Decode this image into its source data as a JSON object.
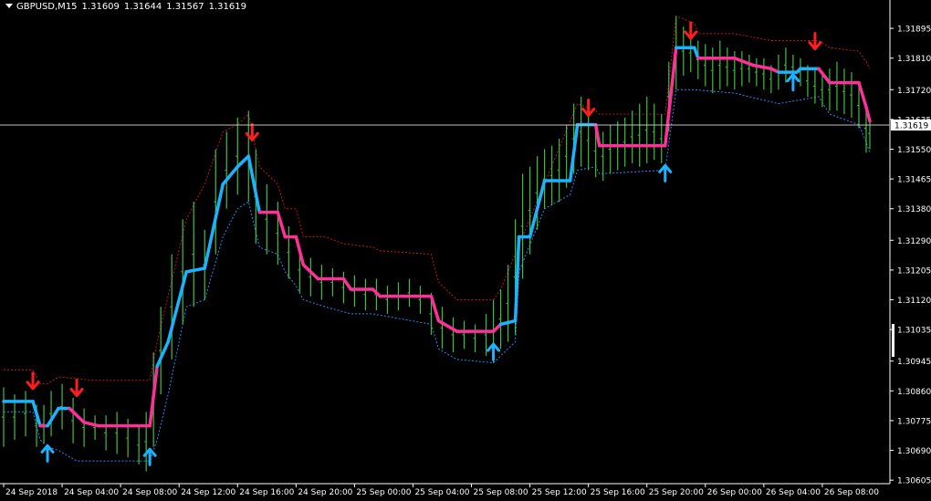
{
  "header": {
    "symbol": "GBPUSD,M15",
    "open": "1.31609",
    "high": "1.31644",
    "low": "1.31567",
    "close": "1.31619"
  },
  "colors": {
    "background": "#000000",
    "bars": "#3fbf3f",
    "up_trend": "#19b4ff",
    "down_trend": "#ff2f9a",
    "upper_band": "#c8141e",
    "lower_band": "#1e8cff",
    "buy_arrow": "#19b4ff",
    "sell_arrow": "#ff1e1e",
    "axis_text": "#ffffff",
    "price_line": "#c0c0c0"
  },
  "chart_data": {
    "type": "line",
    "current_price": {
      "value": 1.31619,
      "label": "1.31619"
    },
    "y_ticks": [
      1.31895,
      1.3181,
      1.3172,
      1.31635,
      1.3155,
      1.31465,
      1.3138,
      1.3129,
      1.31205,
      1.3112,
      1.31035,
      1.30945,
      1.3086,
      1.30775,
      1.3069,
      1.30605
    ],
    "y_tick_labels": [
      "1.31895",
      "1.31810",
      "1.31720",
      "1.31635",
      "1.31550",
      "1.31465",
      "1.31380",
      "1.31290",
      "1.31205",
      "1.31120",
      "1.31035",
      "1.30945",
      "1.30860",
      "1.30775",
      "1.30690",
      "1.30605"
    ],
    "x_labels": [
      "24 Sep 2018",
      "24 Sep 04:00",
      "24 Sep 08:00",
      "24 Sep 12:00",
      "24 Sep 16:00",
      "24 Sep 20:00",
      "25 Sep 00:00",
      "25 Sep 04:00",
      "25 Sep 08:00",
      "25 Sep 12:00",
      "25 Sep 16:00",
      "25 Sep 20:00",
      "26 Sep 00:00",
      "26 Sep 04:00",
      "26 Sep 08:00"
    ],
    "ylim": [
      1.30595,
      1.3195
    ],
    "trend_line": [
      [
        0,
        1.3083,
        "up"
      ],
      [
        8,
        1.3083,
        "up"
      ],
      [
        10,
        1.3076,
        "down"
      ],
      [
        12,
        1.3076,
        "up"
      ],
      [
        15,
        1.3081,
        "up"
      ],
      [
        18,
        1.3081,
        "down"
      ],
      [
        22,
        1.3077,
        "down"
      ],
      [
        26,
        1.3076,
        "down"
      ],
      [
        40,
        1.3076,
        "down"
      ],
      [
        42,
        1.3093,
        "up"
      ],
      [
        45,
        1.31,
        "up"
      ],
      [
        50,
        1.312,
        "up"
      ],
      [
        55,
        1.3121,
        "up"
      ],
      [
        60,
        1.3145,
        "up"
      ],
      [
        64,
        1.315,
        "up"
      ],
      [
        67,
        1.3153,
        "up"
      ],
      [
        70,
        1.3137,
        "down"
      ],
      [
        75,
        1.3137,
        "down"
      ],
      [
        77,
        1.313,
        "down"
      ],
      [
        80,
        1.313,
        "down"
      ],
      [
        82,
        1.3122,
        "down"
      ],
      [
        86,
        1.3118,
        "down"
      ],
      [
        93,
        1.3118,
        "down"
      ],
      [
        95,
        1.3115,
        "down"
      ],
      [
        101,
        1.3115,
        "down"
      ],
      [
        103,
        1.3113,
        "down"
      ],
      [
        117,
        1.3113,
        "down"
      ],
      [
        119,
        1.3106,
        "down"
      ],
      [
        124,
        1.3103,
        "down"
      ],
      [
        134,
        1.3103,
        "down"
      ],
      [
        136,
        1.3105,
        "up"
      ],
      [
        140,
        1.3106,
        "up"
      ],
      [
        141,
        1.313,
        "up"
      ],
      [
        144,
        1.313,
        "up"
      ],
      [
        148,
        1.3146,
        "up"
      ],
      [
        155,
        1.3146,
        "up"
      ],
      [
        157,
        1.3162,
        "up"
      ],
      [
        162,
        1.3162,
        "down"
      ],
      [
        163,
        1.3156,
        "down"
      ],
      [
        181,
        1.3156,
        "down"
      ],
      [
        184,
        1.3184,
        "up"
      ],
      [
        189,
        1.3184,
        "up"
      ],
      [
        190,
        1.3181,
        "down"
      ],
      [
        200,
        1.3181,
        "down"
      ],
      [
        205,
        1.3179,
        "down"
      ],
      [
        210,
        1.3178,
        "down"
      ],
      [
        212,
        1.3177,
        "up"
      ],
      [
        217,
        1.3177,
        "up"
      ],
      [
        218,
        1.3178,
        "up"
      ],
      [
        223,
        1.3178,
        "down"
      ],
      [
        226,
        1.3174,
        "down"
      ],
      [
        234,
        1.3174,
        "down"
      ],
      [
        236,
        1.3167,
        "down"
      ],
      [
        237,
        1.3163,
        "down"
      ]
    ],
    "upper_band": [
      [
        0,
        1.3092
      ],
      [
        8,
        1.3092
      ],
      [
        10,
        1.3088
      ],
      [
        12,
        1.3088
      ],
      [
        15,
        1.309
      ],
      [
        25,
        1.3089
      ],
      [
        30,
        1.3089
      ],
      [
        40,
        1.3089
      ],
      [
        42,
        1.31
      ],
      [
        50,
        1.3135
      ],
      [
        55,
        1.3145
      ],
      [
        60,
        1.316
      ],
      [
        64,
        1.3162
      ],
      [
        67,
        1.3165
      ],
      [
        70,
        1.315
      ],
      [
        75,
        1.3145
      ],
      [
        77,
        1.3138
      ],
      [
        80,
        1.3138
      ],
      [
        82,
        1.313
      ],
      [
        88,
        1.313
      ],
      [
        93,
        1.3128
      ],
      [
        101,
        1.3127
      ],
      [
        103,
        1.3126
      ],
      [
        117,
        1.3125
      ],
      [
        119,
        1.3117
      ],
      [
        124,
        1.3112
      ],
      [
        134,
        1.3112
      ],
      [
        136,
        1.3115
      ],
      [
        157,
        1.3168
      ],
      [
        162,
        1.3166
      ],
      [
        163,
        1.3165
      ],
      [
        181,
        1.3165
      ],
      [
        184,
        1.3193
      ],
      [
        189,
        1.3191
      ],
      [
        190,
        1.3188
      ],
      [
        200,
        1.3188
      ],
      [
        210,
        1.3186
      ],
      [
        223,
        1.3186
      ],
      [
        226,
        1.3184
      ],
      [
        234,
        1.3183
      ],
      [
        236,
        1.318
      ],
      [
        237,
        1.3178
      ]
    ],
    "lower_band": [
      [
        0,
        1.308
      ],
      [
        8,
        1.308
      ],
      [
        10,
        1.3072
      ],
      [
        12,
        1.307
      ],
      [
        15,
        1.3069
      ],
      [
        20,
        1.3066
      ],
      [
        25,
        1.3066
      ],
      [
        40,
        1.3066
      ],
      [
        42,
        1.3072
      ],
      [
        45,
        1.3085
      ],
      [
        50,
        1.311
      ],
      [
        55,
        1.3112
      ],
      [
        60,
        1.313
      ],
      [
        64,
        1.3138
      ],
      [
        67,
        1.314
      ],
      [
        70,
        1.3127
      ],
      [
        75,
        1.3125
      ],
      [
        77,
        1.312
      ],
      [
        80,
        1.3116
      ],
      [
        82,
        1.3112
      ],
      [
        88,
        1.311
      ],
      [
        95,
        1.3108
      ],
      [
        101,
        1.3108
      ],
      [
        117,
        1.3105
      ],
      [
        119,
        1.3098
      ],
      [
        124,
        1.3095
      ],
      [
        134,
        1.3094
      ],
      [
        136,
        1.3096
      ],
      [
        140,
        1.31
      ],
      [
        141,
        1.312
      ],
      [
        148,
        1.3138
      ],
      [
        155,
        1.3142
      ],
      [
        157,
        1.3149
      ],
      [
        162,
        1.315
      ],
      [
        163,
        1.3148
      ],
      [
        181,
        1.3149
      ],
      [
        184,
        1.3172
      ],
      [
        189,
        1.3172
      ],
      [
        200,
        1.3171
      ],
      [
        212,
        1.3168
      ],
      [
        223,
        1.317
      ],
      [
        226,
        1.3165
      ],
      [
        234,
        1.3162
      ],
      [
        236,
        1.3157
      ],
      [
        237,
        1.3154
      ]
    ],
    "price_ranges": [
      [
        0,
        1.307,
        1.3087
      ],
      [
        3,
        1.3072,
        1.3085
      ],
      [
        6,
        1.3073,
        1.3086
      ],
      [
        9,
        1.307,
        1.3082
      ],
      [
        11,
        1.3071,
        1.3082
      ],
      [
        13,
        1.3073,
        1.3086
      ],
      [
        16,
        1.3075,
        1.3088
      ],
      [
        19,
        1.3071,
        1.3084
      ],
      [
        22,
        1.307,
        1.3081
      ],
      [
        25,
        1.3072,
        1.3079
      ],
      [
        28,
        1.3069,
        1.3079
      ],
      [
        31,
        1.3068,
        1.308
      ],
      [
        34,
        1.3067,
        1.3078
      ],
      [
        37,
        1.3065,
        1.3076
      ],
      [
        39,
        1.3063,
        1.308
      ],
      [
        41,
        1.307,
        1.3097
      ],
      [
        43,
        1.3085,
        1.311
      ],
      [
        46,
        1.3095,
        1.3125
      ],
      [
        49,
        1.3105,
        1.3135
      ],
      [
        52,
        1.311,
        1.314
      ],
      [
        55,
        1.3112,
        1.3132
      ],
      [
        58,
        1.3125,
        1.3155
      ],
      [
        61,
        1.3138,
        1.316
      ],
      [
        64,
        1.3142,
        1.3164
      ],
      [
        67,
        1.314,
        1.3166
      ],
      [
        69,
        1.3128,
        1.3155
      ],
      [
        72,
        1.3125,
        1.3145
      ],
      [
        75,
        1.3122,
        1.314
      ],
      [
        78,
        1.3118,
        1.3133
      ],
      [
        81,
        1.3114,
        1.3127
      ],
      [
        84,
        1.3113,
        1.3124
      ],
      [
        87,
        1.3112,
        1.3122
      ],
      [
        90,
        1.3113,
        1.3121
      ],
      [
        93,
        1.3111,
        1.312
      ],
      [
        96,
        1.311,
        1.3119
      ],
      [
        99,
        1.3109,
        1.3118
      ],
      [
        102,
        1.3109,
        1.3118
      ],
      [
        105,
        1.3108,
        1.3116
      ],
      [
        108,
        1.3109,
        1.3117
      ],
      [
        111,
        1.311,
        1.3118
      ],
      [
        114,
        1.3108,
        1.3116
      ],
      [
        117,
        1.3102,
        1.3114
      ],
      [
        120,
        1.3098,
        1.311
      ],
      [
        123,
        1.3097,
        1.3107
      ],
      [
        126,
        1.3098,
        1.3106
      ],
      [
        129,
        1.3097,
        1.3105
      ],
      [
        132,
        1.3096,
        1.3108
      ],
      [
        134,
        1.3094,
        1.3112
      ],
      [
        136,
        1.3098,
        1.3115
      ],
      [
        138,
        1.31,
        1.3122
      ],
      [
        140,
        1.3102,
        1.3135
      ],
      [
        142,
        1.3118,
        1.3148
      ],
      [
        144,
        1.3125,
        1.315
      ],
      [
        146,
        1.3132,
        1.3153
      ],
      [
        148,
        1.3138,
        1.3155
      ],
      [
        150,
        1.3139,
        1.3156
      ],
      [
        152,
        1.314,
        1.3158
      ],
      [
        154,
        1.3144,
        1.3162
      ],
      [
        156,
        1.3148,
        1.3168
      ],
      [
        158,
        1.315,
        1.317
      ],
      [
        160,
        1.3149,
        1.3166
      ],
      [
        162,
        1.3147,
        1.3162
      ],
      [
        164,
        1.3146,
        1.316
      ],
      [
        166,
        1.3148,
        1.3162
      ],
      [
        168,
        1.3149,
        1.3163
      ],
      [
        170,
        1.315,
        1.3164
      ],
      [
        172,
        1.3151,
        1.3166
      ],
      [
        174,
        1.315,
        1.3168
      ],
      [
        176,
        1.3151,
        1.317
      ],
      [
        178,
        1.3152,
        1.3168
      ],
      [
        180,
        1.3151,
        1.3165
      ],
      [
        182,
        1.316,
        1.318
      ],
      [
        184,
        1.3172,
        1.3193
      ],
      [
        186,
        1.3176,
        1.319
      ],
      [
        188,
        1.3177,
        1.3188
      ],
      [
        190,
        1.3175,
        1.3186
      ],
      [
        192,
        1.3173,
        1.3185
      ],
      [
        194,
        1.3171,
        1.3184
      ],
      [
        196,
        1.3172,
        1.3186
      ],
      [
        198,
        1.3173,
        1.3184
      ],
      [
        200,
        1.3172,
        1.3183
      ],
      [
        202,
        1.3173,
        1.3183
      ],
      [
        204,
        1.3174,
        1.3182
      ],
      [
        206,
        1.3173,
        1.3181
      ],
      [
        208,
        1.3172,
        1.3181
      ],
      [
        210,
        1.3171,
        1.3179
      ],
      [
        212,
        1.3172,
        1.3182
      ],
      [
        214,
        1.3174,
        1.3184
      ],
      [
        216,
        1.3175,
        1.3182
      ],
      [
        218,
        1.3173,
        1.3181
      ],
      [
        220,
        1.317,
        1.3179
      ],
      [
        222,
        1.3168,
        1.3178
      ],
      [
        224,
        1.3167,
        1.3177
      ],
      [
        226,
        1.3166,
        1.3178
      ],
      [
        228,
        1.3166,
        1.318
      ],
      [
        230,
        1.3165,
        1.3178
      ],
      [
        232,
        1.3164,
        1.3177
      ],
      [
        234,
        1.3161,
        1.3174
      ],
      [
        236,
        1.3154,
        1.3168
      ],
      [
        237,
        1.3155,
        1.3164
      ]
    ],
    "arrows": [
      [
        8,
        1.3089,
        "sell"
      ],
      [
        12,
        1.3068,
        "buy"
      ],
      [
        20,
        1.3087,
        "sell"
      ],
      [
        40,
        1.3067,
        "buy"
      ],
      [
        68,
        1.316,
        "sell"
      ],
      [
        134,
        1.3097,
        "buy"
      ],
      [
        160,
        1.3167,
        "sell"
      ],
      [
        181,
        1.3148,
        "buy"
      ],
      [
        188,
        1.3189,
        "sell"
      ],
      [
        216,
        1.3174,
        "buy"
      ],
      [
        222,
        1.3186,
        "sell"
      ]
    ]
  }
}
